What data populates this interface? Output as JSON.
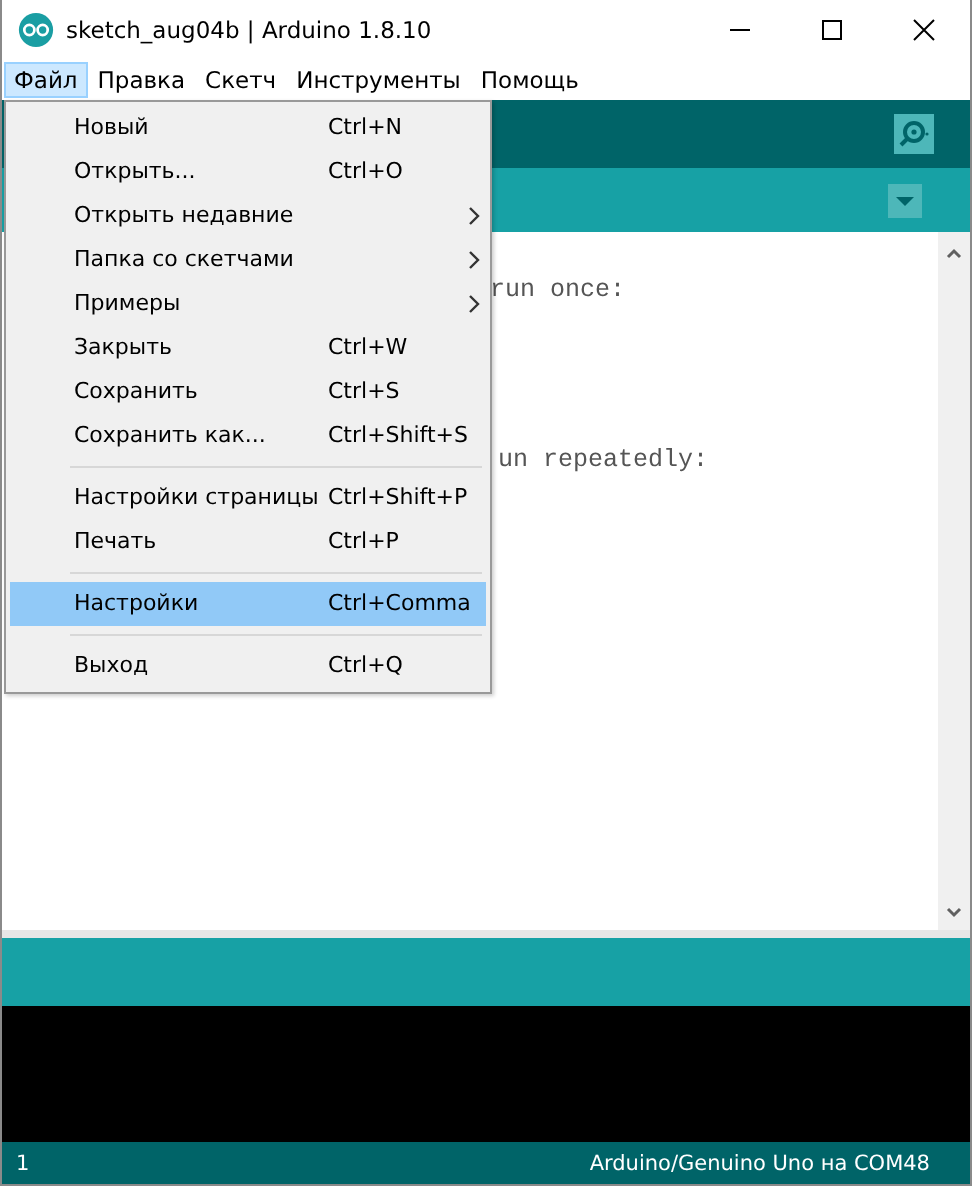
{
  "window": {
    "title": "sketch_aug04b | Arduino 1.8.10"
  },
  "menubar": [
    {
      "label": "Файл",
      "selected": true
    },
    {
      "label": "Правка",
      "selected": false
    },
    {
      "label": "Скетч",
      "selected": false
    },
    {
      "label": "Инструменты",
      "selected": false
    },
    {
      "label": "Помощь",
      "selected": false
    }
  ],
  "menu": {
    "groups": [
      [
        {
          "label": "Новый",
          "shortcut": "Ctrl+N",
          "submenu": false,
          "selected": false
        },
        {
          "label": "Открыть...",
          "shortcut": "Ctrl+O",
          "submenu": false,
          "selected": false
        },
        {
          "label": "Открыть недавние",
          "submenu": true,
          "selected": false
        },
        {
          "label": "Папка со скетчами",
          "submenu": true,
          "selected": false
        },
        {
          "label": "Примеры",
          "submenu": true,
          "selected": false
        },
        {
          "label": "Закрыть",
          "shortcut": "Ctrl+W",
          "submenu": false,
          "selected": false
        },
        {
          "label": "Сохранить",
          "shortcut": "Ctrl+S",
          "submenu": false,
          "selected": false
        },
        {
          "label": "Сохранить как...",
          "shortcut": "Ctrl+Shift+S",
          "submenu": false,
          "selected": false
        }
      ],
      [
        {
          "label": "Настройки страницы",
          "shortcut": "Ctrl+Shift+P",
          "submenu": false,
          "selected": false
        },
        {
          "label": "Печать",
          "shortcut": "Ctrl+P",
          "submenu": false,
          "selected": false
        }
      ],
      [
        {
          "label": "Настройки",
          "shortcut": "Ctrl+Comma",
          "submenu": false,
          "selected": true
        }
      ],
      [
        {
          "label": "Выход",
          "shortcut": "Ctrl+Q",
          "submenu": false,
          "selected": false
        }
      ]
    ]
  },
  "editor": {
    "lines": [
      "run once:",
      "un repeatedly:"
    ]
  },
  "status_bar": {
    "line": "1",
    "board": "Arduino/Genuino Uno на COM48"
  }
}
